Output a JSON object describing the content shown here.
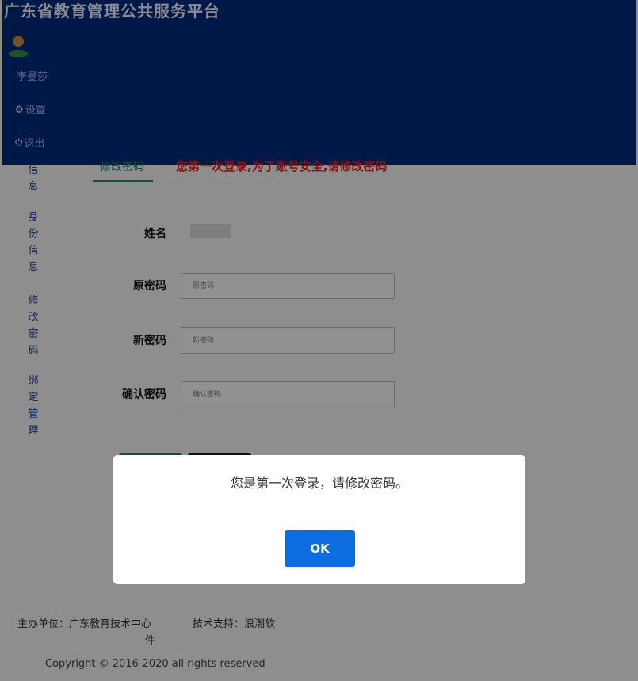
{
  "header": {
    "title": "广东省教育管理公共服务平台",
    "user_name": "李曼莎",
    "settings_label": "设置",
    "logout_label": "退出"
  },
  "sidebar": {
    "items": [
      {
        "label": "信息"
      },
      {
        "label": "身份信息"
      },
      {
        "label": "修改密码"
      },
      {
        "label": "绑定管理"
      }
    ]
  },
  "tabs": {
    "active_label": "修改密码",
    "warning": "您第一次登录,为了账号安全,请修改密码"
  },
  "form": {
    "name_label": "姓名",
    "old_password_label": "原密码",
    "old_password_placeholder": "原密码",
    "new_password_label": "新密码",
    "new_password_placeholder": "新密码",
    "confirm_password_label": "确认密码",
    "confirm_password_placeholder": "确认密码"
  },
  "footer": {
    "host": "主办单位：广东教育技术中心",
    "host_wrap": "件",
    "support": "技术支持：浪潮软",
    "copyright": "Copyright © 2016-2020 all rights reserved"
  },
  "modal": {
    "message": "您是第一次登录，请修改密码。",
    "ok_label": "OK"
  },
  "colors": {
    "header_bg": "#002a7a",
    "accent_green": "#1b8a70",
    "warning_red": "#e02020",
    "ok_blue": "#0b6de0"
  }
}
